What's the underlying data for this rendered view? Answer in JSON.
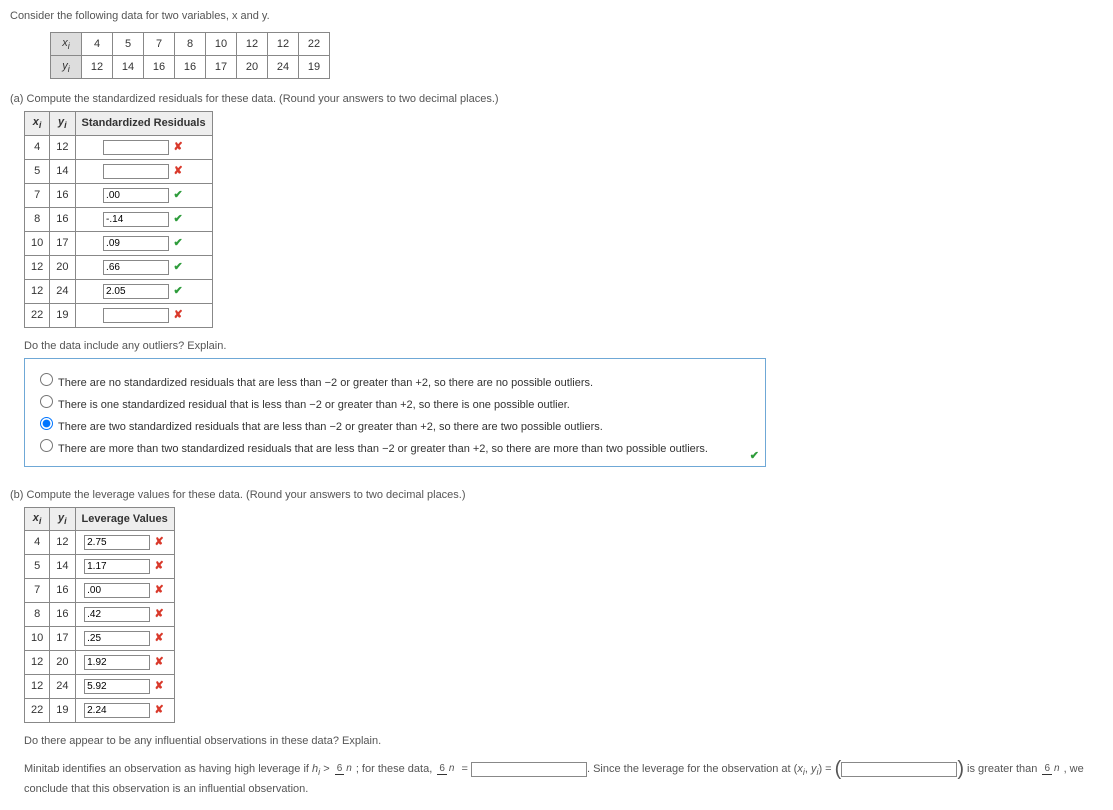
{
  "intro": "Consider the following data for two variables, x and y.",
  "data_table": {
    "rows": [
      {
        "label": "x",
        "sub": "i",
        "values": [
          "4",
          "5",
          "7",
          "8",
          "10",
          "12",
          "12",
          "22"
        ]
      },
      {
        "label": "y",
        "sub": "i",
        "values": [
          "12",
          "14",
          "16",
          "16",
          "17",
          "20",
          "24",
          "19"
        ]
      }
    ]
  },
  "partA": {
    "prefix": "(a)",
    "prompt": "Compute the standardized residuals for these data. (Round your answers to two decimal places.)",
    "headers": {
      "xi": "x",
      "xi_sub": "i",
      "yi": "y",
      "yi_sub": "i",
      "resid": "Standardized Residuals"
    },
    "rows": [
      {
        "x": "4",
        "y": "12",
        "value": "",
        "mark": "incorrect"
      },
      {
        "x": "5",
        "y": "14",
        "value": "",
        "mark": "incorrect"
      },
      {
        "x": "7",
        "y": "16",
        "value": ".00",
        "mark": "correct"
      },
      {
        "x": "8",
        "y": "16",
        "value": "-.14",
        "mark": "correct"
      },
      {
        "x": "10",
        "y": "17",
        "value": ".09",
        "mark": "correct"
      },
      {
        "x": "12",
        "y": "20",
        "value": ".66",
        "mark": "correct"
      },
      {
        "x": "12",
        "y": "24",
        "value": "2.05",
        "mark": "correct"
      },
      {
        "x": "22",
        "y": "19",
        "value": "",
        "mark": "incorrect"
      }
    ],
    "subq": "Do the data include any outliers? Explain.",
    "mc": {
      "selected": 2,
      "options": [
        "There are no standardized residuals that are less than −2 or greater than +2, so there are no possible outliers.",
        "There is one standardized residual that is less than −2 or greater than +2, so there is one possible outlier.",
        "There are two standardized residuals that are less than −2 or greater than +2, so there are two possible outliers.",
        "There are more than two standardized residuals that are less than −2 or greater than +2, so there are more than two possible outliers."
      ],
      "feedback_mark": "correct"
    }
  },
  "partB": {
    "prefix": "(b)",
    "prompt": "Compute the leverage values for these data. (Round your answers to two decimal places.)",
    "headers": {
      "xi": "x",
      "xi_sub": "i",
      "yi": "y",
      "yi_sub": "i",
      "lev": "Leverage Values"
    },
    "rows": [
      {
        "x": "4",
        "y": "12",
        "value": "2.75",
        "mark": "incorrect"
      },
      {
        "x": "5",
        "y": "14",
        "value": "1.17",
        "mark": "incorrect"
      },
      {
        "x": "7",
        "y": "16",
        "value": ".00",
        "mark": "incorrect"
      },
      {
        "x": "8",
        "y": "16",
        "value": ".42",
        "mark": "incorrect"
      },
      {
        "x": "10",
        "y": "17",
        "value": ".25",
        "mark": "incorrect"
      },
      {
        "x": "12",
        "y": "20",
        "value": "1.92",
        "mark": "incorrect"
      },
      {
        "x": "12",
        "y": "24",
        "value": "5.92",
        "mark": "incorrect"
      },
      {
        "x": "22",
        "y": "19",
        "value": "2.24",
        "mark": "incorrect"
      }
    ],
    "subq": "Do there appear to be any influential observations in these data? Explain.",
    "sentence": {
      "t1": "Minitab identifies an observation as having high leverage if ",
      "hi": "h",
      "hi_sub": "i",
      "gt": " > ",
      "frac_top": "6",
      "frac_bot": "n",
      "t2": "; for these data, ",
      "eq": " = ",
      "t3": ". Since the leverage for the observation at (",
      "xi": "x",
      "xi_sub": "i",
      "comma": ", ",
      "yi": "y",
      "yi_sub": "i",
      "t4": ") = ",
      "t5": " is greater than ",
      "t6": ", we conclude that this observation is an influential observation."
    }
  },
  "marks": {
    "correct": "✔",
    "incorrect": "✘"
  }
}
